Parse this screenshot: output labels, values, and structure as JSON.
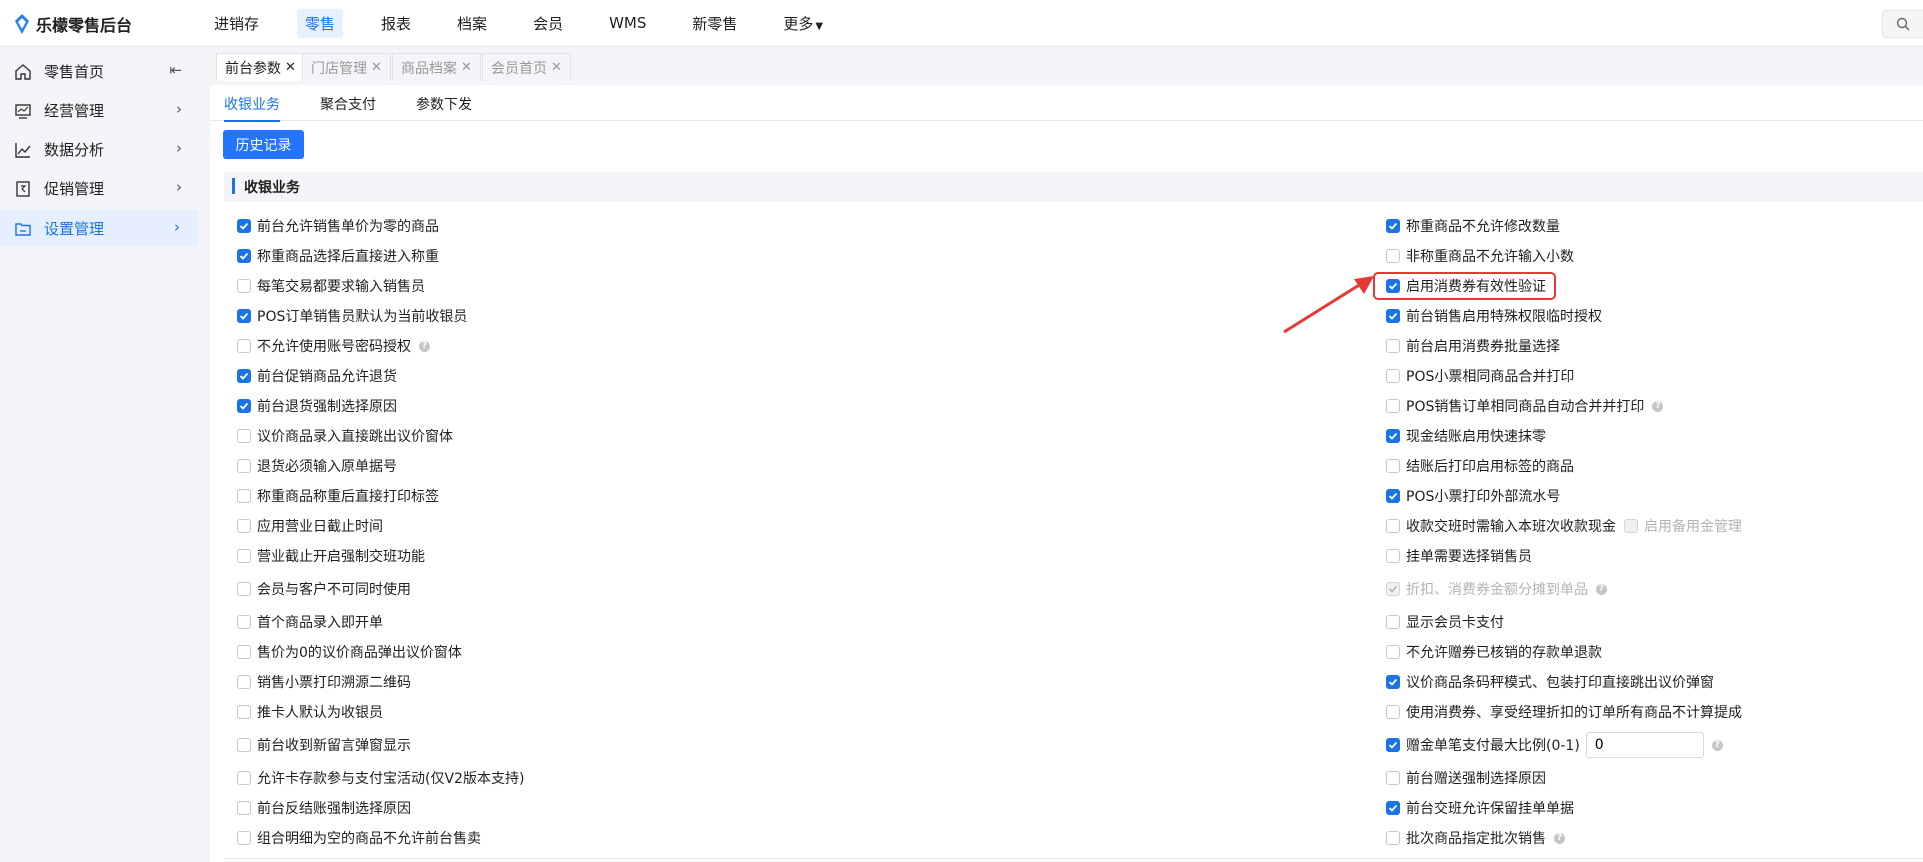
{
  "app": {
    "title": "乐檬零售后台"
  },
  "topnav": {
    "items": [
      "进销存",
      "零售",
      "报表",
      "档案",
      "会员",
      "WMS",
      "新零售",
      "更多"
    ],
    "active_index": 1
  },
  "sidebar": {
    "items": [
      {
        "label": "零售首页",
        "icon": "home-icon"
      },
      {
        "label": "经营管理",
        "icon": "monitor-icon"
      },
      {
        "label": "数据分析",
        "icon": "chart-line-icon"
      },
      {
        "label": "促销管理",
        "icon": "promo-icon"
      },
      {
        "label": "设置管理",
        "icon": "settings-folder-icon"
      }
    ],
    "active_index": 4
  },
  "tabs": [
    {
      "label": "前台参数",
      "active": true
    },
    {
      "label": "门店管理",
      "active": false
    },
    {
      "label": "商品档案",
      "active": false
    },
    {
      "label": "会员首页",
      "active": false
    }
  ],
  "subtabs": [
    "收银业务",
    "聚合支付",
    "参数下发"
  ],
  "history_button": "历史记录",
  "section_title": "收银业务",
  "left_options": [
    {
      "label": "前台允许销售单价为零的商品",
      "checked": true
    },
    {
      "label": "称重商品选择后直接进入称重",
      "checked": true
    },
    {
      "label": "每笔交易都要求输入销售员",
      "checked": false
    },
    {
      "label": "POS订单销售员默认为当前收银员",
      "checked": true
    },
    {
      "label": "不允许使用账号密码授权",
      "checked": false,
      "help": true
    },
    {
      "label": "前台促销商品允许退货",
      "checked": true
    },
    {
      "label": "前台退货强制选择原因",
      "checked": true
    },
    {
      "label": "议价商品录入直接跳出议价窗体",
      "checked": false
    },
    {
      "label": "退货必须输入原单据号",
      "checked": false
    },
    {
      "label": "称重商品称重后直接打印标签",
      "checked": false
    },
    {
      "label": "应用营业日截止时间",
      "checked": false
    },
    {
      "label": "营业截止开启强制交班功能",
      "checked": false
    },
    {
      "label": "会员与客户不可同时使用",
      "checked": false
    },
    {
      "label": "首个商品录入即开单",
      "checked": false
    },
    {
      "label": "售价为0的议价商品弹出议价窗体",
      "checked": false
    },
    {
      "label": "销售小票打印溯源二维码",
      "checked": false
    },
    {
      "label": "推卡人默认为收银员",
      "checked": false
    },
    {
      "label": "前台收到新留言弹窗显示",
      "checked": false
    },
    {
      "label": "允许卡存款参与支付宝活动(仅V2版本支持)",
      "checked": false
    },
    {
      "label": "前台反结账强制选择原因",
      "checked": false
    },
    {
      "label": "组合明细为空的商品不允许前台售卖",
      "checked": false
    }
  ],
  "right_options": [
    {
      "label": "称重商品不允许修改数量",
      "checked": true
    },
    {
      "label": "非称重商品不允许输入小数",
      "checked": false
    },
    {
      "label": "启用消费券有效性验证",
      "checked": true,
      "highlighted": true
    },
    {
      "label": "前台销售启用特殊权限临时授权",
      "checked": true
    },
    {
      "label": "前台启用消费券批量选择",
      "checked": false
    },
    {
      "label": "POS小票相同商品合并打印",
      "checked": false
    },
    {
      "label": "POS销售订单相同商品自动合并并打印",
      "checked": false,
      "help": true
    },
    {
      "label": "现金结账启用快速抹零",
      "checked": true
    },
    {
      "label": "结账后打印启用标签的商品",
      "checked": false
    },
    {
      "label": "POS小票打印外部流水号",
      "checked": true
    },
    {
      "label": "收款交班时需输入本班次收款现金",
      "checked": false,
      "sub_label": "启用备用金管理"
    },
    {
      "label": "挂单需要选择销售员",
      "checked": false
    },
    {
      "label": "折扣、消费券金额分摊到单品",
      "checked": true,
      "disabled": true,
      "help": true
    },
    {
      "label": "显示会员卡支付",
      "checked": false
    },
    {
      "label": "不允许赠券已核销的存款单退款",
      "checked": false
    },
    {
      "label": "议价商品条码秤模式、包装打印直接跳出议价弹窗",
      "checked": true
    },
    {
      "label": "使用消费券、享受经理折扣的订单所有商品不计算提成",
      "checked": false
    },
    {
      "label": "赠金单笔支付最大比例(0-1)",
      "checked": true,
      "input_value": "0",
      "help": true
    },
    {
      "label": "前台赠送强制选择原因",
      "checked": false
    },
    {
      "label": "前台交班允许保留挂单单据",
      "checked": true
    },
    {
      "label": "批次商品指定批次销售",
      "checked": false,
      "help": true
    }
  ],
  "colors": {
    "accent": "#1a73e8",
    "highlight": "#e53935"
  }
}
